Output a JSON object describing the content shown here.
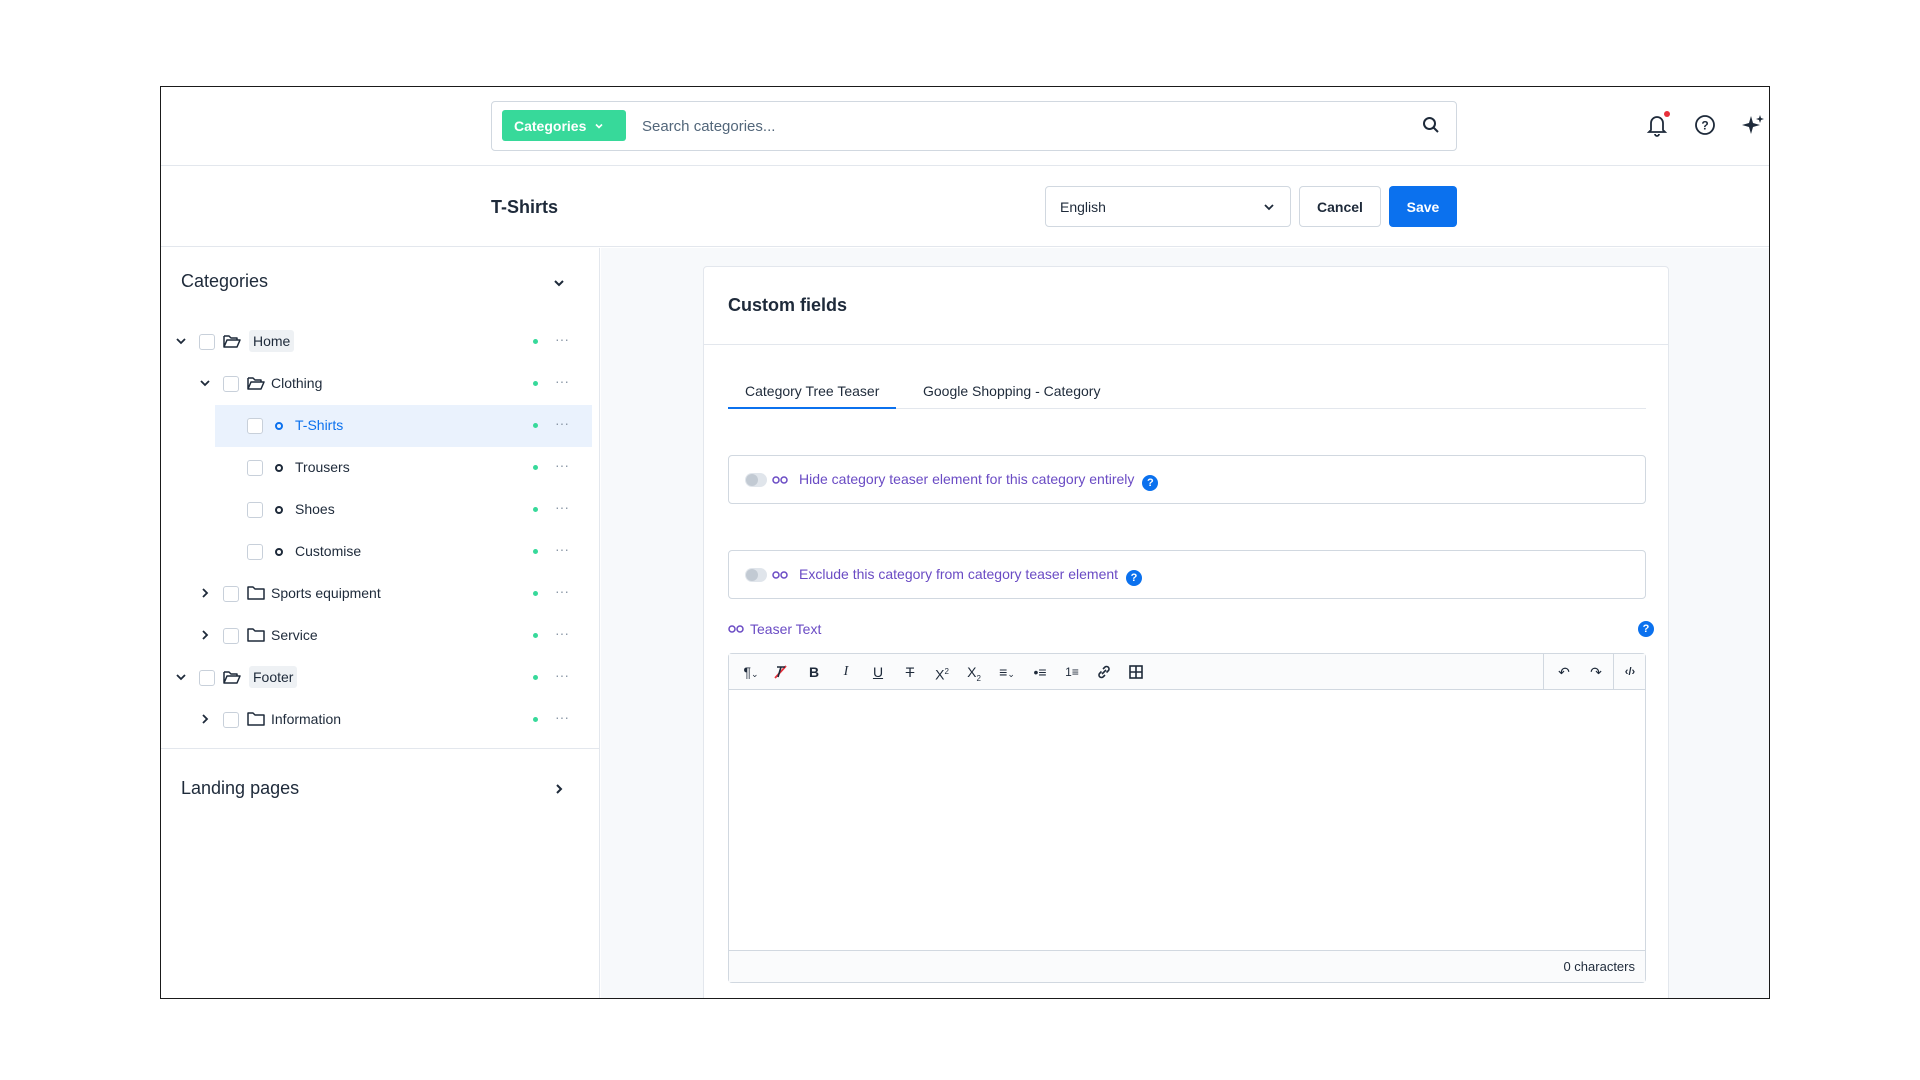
{
  "search": {
    "scope_label": "Categories",
    "placeholder": "Search categories..."
  },
  "header": {
    "title": "T-Shirts",
    "language": "English",
    "cancel_label": "Cancel",
    "save_label": "Save"
  },
  "sidebar": {
    "categories_heading": "Categories",
    "landing_heading": "Landing pages",
    "tree": [
      {
        "label": "Home",
        "expanded": true,
        "level": 0,
        "status": "active"
      },
      {
        "label": "Clothing",
        "expanded": true,
        "level": 1,
        "status": "active"
      },
      {
        "label": "T-Shirts",
        "level": 2,
        "selected": true,
        "status": "active"
      },
      {
        "label": "Trousers",
        "level": 2,
        "status": "active"
      },
      {
        "label": "Shoes",
        "level": 2,
        "status": "active"
      },
      {
        "label": "Customise",
        "level": 2,
        "status": "active"
      },
      {
        "label": "Sports equipment",
        "expanded": false,
        "level": 1,
        "status": "active"
      },
      {
        "label": "Service",
        "expanded": false,
        "level": 1,
        "status": "active"
      },
      {
        "label": "Footer",
        "expanded": true,
        "level": 0,
        "status": "active"
      },
      {
        "label": "Information",
        "expanded": false,
        "level": 1,
        "status": "active"
      }
    ]
  },
  "main": {
    "card_title": "Custom fields",
    "tabs": [
      {
        "label": "Category Tree Teaser",
        "active": true
      },
      {
        "label": "Google Shopping - Category",
        "active": false
      }
    ],
    "fields": [
      {
        "label": "Hide category teaser element for this category entirely",
        "enabled": false
      },
      {
        "label": "Exclude this category from category teaser element",
        "enabled": false
      }
    ],
    "teaser_label": "Teaser Text",
    "help_glyph": "?",
    "char_count": "0 characters"
  },
  "colors": {
    "accent_blue": "#0b71ee",
    "scope_green": "#37d99a",
    "inherit_purple": "#6a4bc4",
    "notification_red": "#e8303b"
  }
}
